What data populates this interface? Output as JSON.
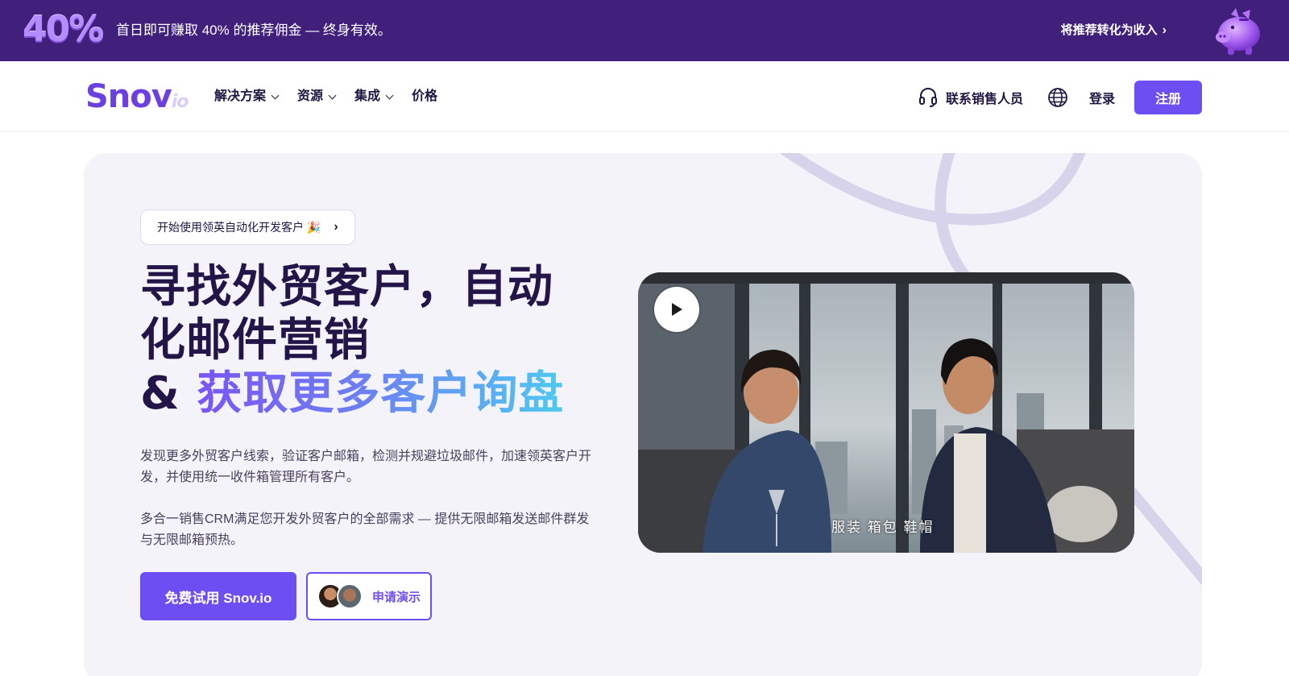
{
  "promo": {
    "badge": "40%",
    "text": "首日即可赚取 40% 的推荐佣金 — 终身有效。",
    "link": "将推荐转化为收入",
    "link_chevron": "›"
  },
  "nav": {
    "logo_main": "Snov",
    "logo_suffix": "io",
    "menu": [
      {
        "label": "解决方案"
      },
      {
        "label": "资源"
      },
      {
        "label": "集成"
      },
      {
        "label": "价格"
      }
    ],
    "contact": "联系销售人员",
    "login": "登录",
    "signup": "注册"
  },
  "hero": {
    "pill": "开始使用领英自动化开发客户 🎉",
    "pill_chevron": "›",
    "headline_line1": "寻找外贸客户，自动",
    "headline_line2": "化邮件营销",
    "headline_amp": "& ",
    "headline_highlight": "获取更多客户询盘",
    "para1": "发现更多外贸客户线索，验证客户邮箱，检测并规避垃圾邮件，加速领英客户开发，并使用统一收件箱管理所有客户。",
    "para2": "多合一销售CRM满足您开发外贸客户的全部需求 — 提供无限邮箱发送邮件群发与无限邮箱预热。",
    "cta_primary": "免费试用 Snov.io",
    "cta_demo": "申请演示",
    "video_subtitle": "服装 箱包 鞋帽"
  },
  "colors": {
    "banner_bg": "#41207b",
    "brand": "#6c4ef2",
    "hero_bg": "#f4f3fa",
    "heading": "#231548"
  },
  "icons": [
    "piggy-bank-icon",
    "chevron-down-icon",
    "headset-icon",
    "globe-icon",
    "chevron-right-icon",
    "play-icon"
  ]
}
